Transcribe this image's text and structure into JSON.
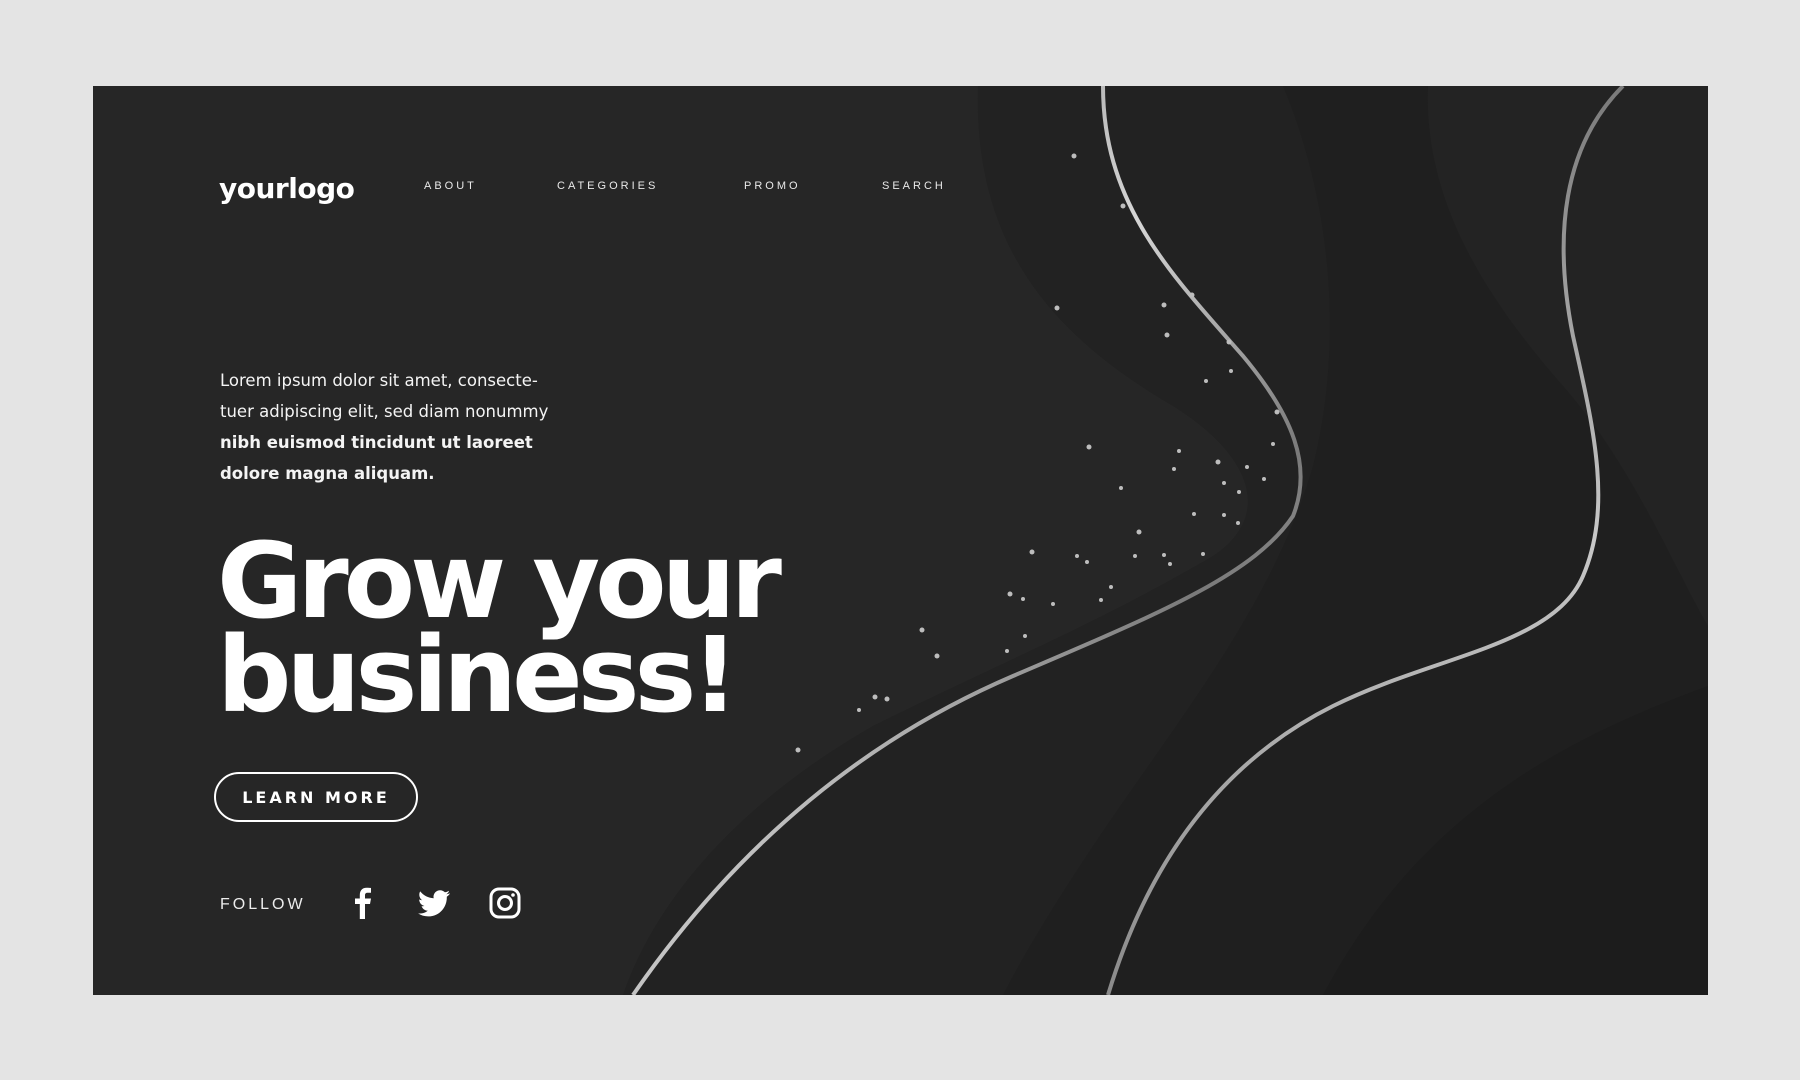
{
  "header": {
    "logo": "yourlogo",
    "nav": [
      {
        "label": "ABOUT"
      },
      {
        "label": "CATEGORIES"
      },
      {
        "label": "PROMO"
      },
      {
        "label": "SEARCH"
      }
    ]
  },
  "hero": {
    "intro_plain": "Lorem ipsum dolor sit amet, consecte- tuer adipiscing elit, sed diam nonummy ",
    "intro_bold": "nibh euismod tincidunt ut laoreet dolore magna aliquam.",
    "headline_line1": "Grow your",
    "headline_line2": "business!",
    "cta_label": "LEARN MORE"
  },
  "social": {
    "follow_label": "FOLLOW",
    "icons": [
      "facebook-icon",
      "twitter-icon",
      "instagram-icon"
    ]
  },
  "colors": {
    "page_background": "#e4e4e4",
    "panel_background": "#262626",
    "text": "#ffffff",
    "accent_line": "#9a9a9a"
  }
}
